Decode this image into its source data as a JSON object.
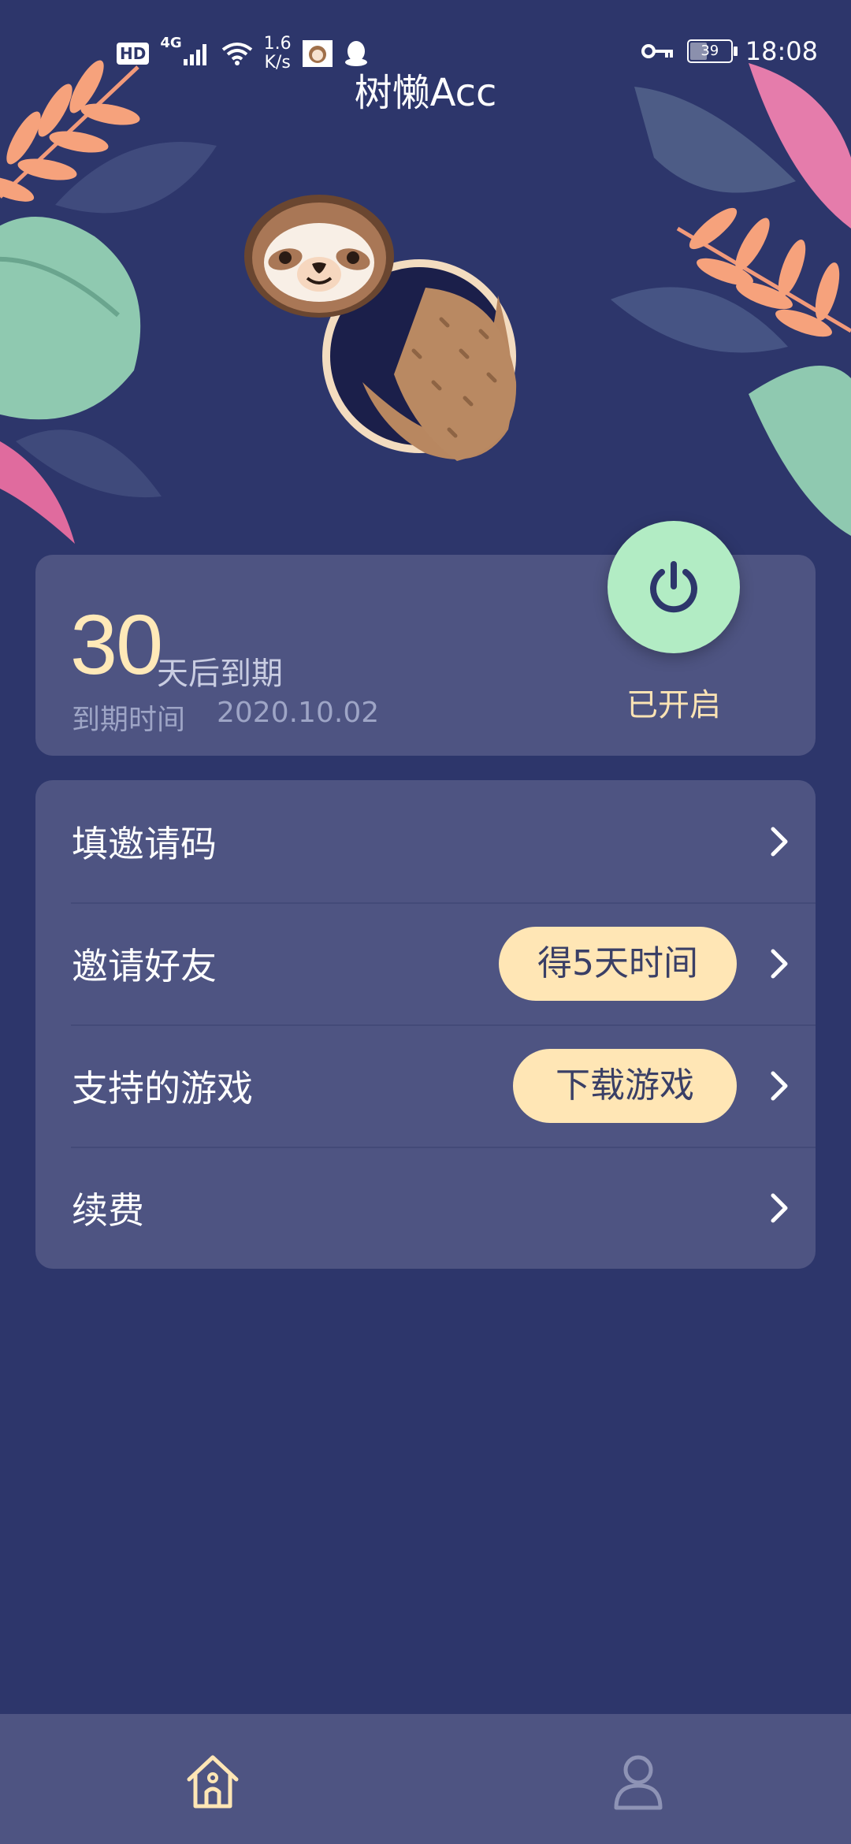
{
  "status_bar": {
    "hd_label": "HD",
    "network_type": "4G",
    "net_speed_value": "1.6",
    "net_speed_unit": "K/s",
    "battery_level": "39",
    "time": "18:08",
    "icons": [
      "signal-icon",
      "wifi-icon",
      "app-notification-icon",
      "qq-icon",
      "vpn-key-icon",
      "battery-icon"
    ]
  },
  "header": {
    "title": "树懒Acc"
  },
  "status_card": {
    "days_remaining": "30",
    "days_suffix": "天后到期",
    "expire_label": "到期时间",
    "expire_date": "2020.10.02",
    "power_state": "已开启"
  },
  "menu": {
    "items": [
      {
        "label": "填邀请码",
        "badge": ""
      },
      {
        "label": "邀请好友",
        "badge": "得5天时间"
      },
      {
        "label": "支持的游戏",
        "badge": "下载游戏"
      },
      {
        "label": "续费",
        "badge": ""
      }
    ]
  },
  "tab_bar": {
    "tabs": [
      {
        "icon": "home-icon",
        "active": true
      },
      {
        "icon": "user-icon",
        "active": false
      }
    ]
  },
  "colors": {
    "background": "#2d366b",
    "card": "#4e5482",
    "accent_cream": "#ffe6b5",
    "power_green": "#b2ecc4",
    "muted_text": "#9ea5c6"
  }
}
